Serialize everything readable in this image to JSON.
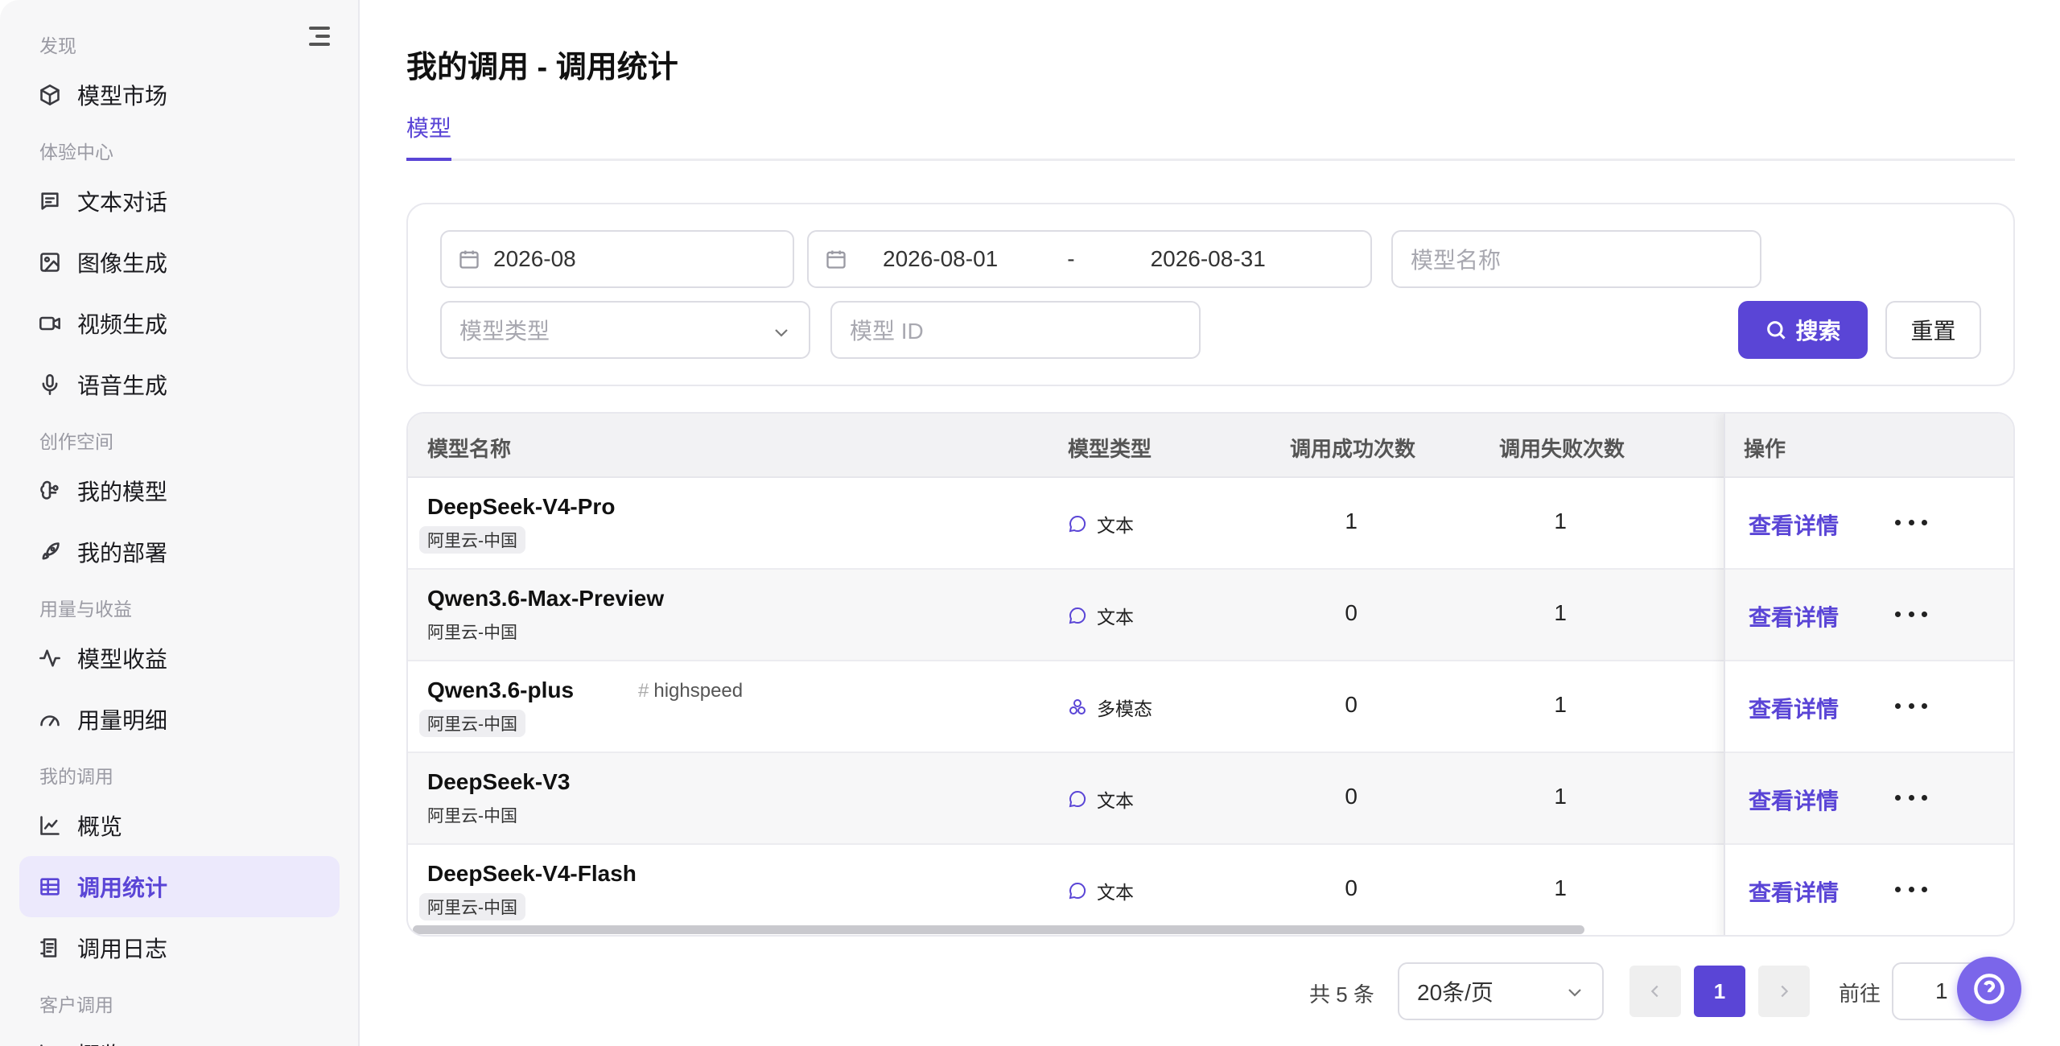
{
  "sidebar": {
    "sections": [
      "发现",
      "体验中心",
      "创作空间",
      "用量与收益",
      "我的调用",
      "客户调用"
    ],
    "items": [
      {
        "label": "模型市场",
        "icon": "cube-icon"
      },
      {
        "label": "文本对话",
        "icon": "message-square-icon"
      },
      {
        "label": "图像生成",
        "icon": "image-icon"
      },
      {
        "label": "视频生成",
        "icon": "video-icon"
      },
      {
        "label": "语音生成",
        "icon": "microphone-icon"
      },
      {
        "label": "我的模型",
        "icon": "brain-icon"
      },
      {
        "label": "我的部署",
        "icon": "rocket-icon"
      },
      {
        "label": "模型收益",
        "icon": "activity-icon"
      },
      {
        "label": "用量明细",
        "icon": "gauge-icon"
      },
      {
        "label": "概览",
        "icon": "line-chart-icon"
      },
      {
        "label": "调用统计",
        "icon": "table-icon",
        "active": true
      },
      {
        "label": "调用日志",
        "icon": "log-icon"
      },
      {
        "label": "概览",
        "icon": "line-chart-icon"
      }
    ]
  },
  "header": {
    "title": "我的调用 - 调用统计"
  },
  "tabs": [
    {
      "label": "模型",
      "active": true
    }
  ],
  "filters": {
    "month": "2026-08",
    "date_start": "2026-08-01",
    "date_sep": "-",
    "date_end": "2026-08-31",
    "model_name_placeholder": "模型名称",
    "model_type_placeholder": "模型类型",
    "model_id_placeholder": "模型 ID",
    "search_label": "搜索",
    "reset_label": "重置"
  },
  "table": {
    "columns": [
      "模型名称",
      "模型类型",
      "调用成功次数",
      "调用失败次数",
      "操作"
    ],
    "rows": [
      {
        "name": "DeepSeek-V4-Pro",
        "tag": "",
        "provider": "阿里云-中国",
        "type": "文本",
        "type_icon": "chat-bubble-icon",
        "success": "1",
        "fail": "1",
        "action": "查看详情"
      },
      {
        "name": "Qwen3.6-Max-Preview",
        "tag": "",
        "provider": "阿里云-中国",
        "type": "文本",
        "type_icon": "chat-bubble-icon",
        "success": "0",
        "fail": "1",
        "action": "查看详情"
      },
      {
        "name": "Qwen3.6-plus",
        "tag": "highspeed",
        "tag_prefix": "#",
        "provider": "阿里云-中国",
        "type": "多模态",
        "type_icon": "multimodal-icon",
        "success": "0",
        "fail": "1",
        "action": "查看详情"
      },
      {
        "name": "DeepSeek-V3",
        "tag": "",
        "provider": "阿里云-中国",
        "type": "文本",
        "type_icon": "chat-bubble-icon",
        "success": "0",
        "fail": "1",
        "action": "查看详情"
      },
      {
        "name": "DeepSeek-V4-Flash",
        "tag": "",
        "provider": "阿里云-中国",
        "type": "文本",
        "type_icon": "chat-bubble-icon",
        "success": "0",
        "fail": "1",
        "action": "查看详情"
      }
    ]
  },
  "pagination": {
    "total": "共 5 条",
    "page_size": "20条/页",
    "current_page": "1",
    "goto_label": "前往",
    "goto_value": "1"
  },
  "colors": {
    "accent": "#5a45d6",
    "active_bg": "#ece9fc"
  }
}
